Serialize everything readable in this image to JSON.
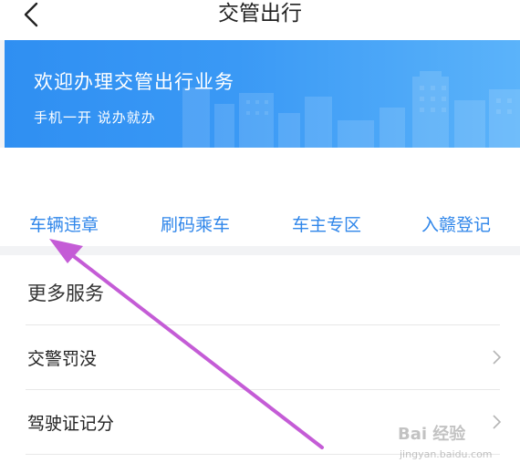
{
  "nav": {
    "title": "交管出行",
    "back_icon": "chevron-left-icon"
  },
  "banner": {
    "title": "欢迎办理交管出行业务",
    "subtitle": "手机一开 说办就办",
    "gradient_start": "#2f8ff2",
    "gradient_end": "#5bb3fa"
  },
  "quick_entries": [
    {
      "label": "车辆违章"
    },
    {
      "label": "刷码乘车"
    },
    {
      "label": "车主专区"
    },
    {
      "label": "入赣登记"
    }
  ],
  "more_services": {
    "title": "更多服务",
    "items": [
      {
        "label": "交警罚没",
        "icon": "chevron-right-icon"
      },
      {
        "label": "驾驶证记分",
        "icon": "chevron-right-icon"
      }
    ]
  },
  "annotation": {
    "arrow_color": "#c45cd6",
    "points_to": "车辆违章"
  },
  "watermark": {
    "brand": "Bai 经验",
    "url": "jingyan.baidu.com"
  },
  "colors": {
    "accent": "#2f86ea",
    "background": "#f2f3f5"
  }
}
